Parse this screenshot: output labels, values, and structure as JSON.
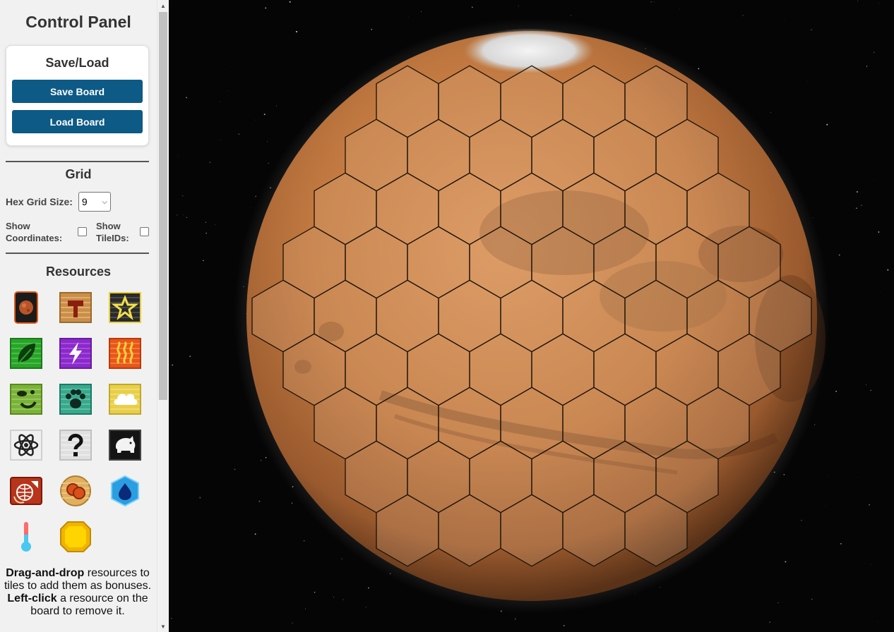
{
  "panel": {
    "title": "Control Panel",
    "saveload": {
      "title": "Save/Load",
      "save_label": "Save Board",
      "load_label": "Load Board"
    },
    "grid": {
      "title": "Grid",
      "size_label": "Hex Grid Size:",
      "size_value": "9",
      "show_coords_label_1": "Show",
      "show_coords_label_2": "Coordinates:",
      "show_tileids_label_1": "Show",
      "show_tileids_label_2": "TileIDs:"
    },
    "resources": {
      "title": "Resources",
      "items": [
        {
          "icon": "mars-card-icon"
        },
        {
          "icon": "building-tag-icon"
        },
        {
          "icon": "star-tag-icon"
        },
        {
          "icon": "plant-tag-icon"
        },
        {
          "icon": "power-tag-icon"
        },
        {
          "icon": "heat-tag-icon"
        },
        {
          "icon": "microbe-tag-icon"
        },
        {
          "icon": "animal-tag-icon"
        },
        {
          "icon": "cloud-tag-icon"
        },
        {
          "icon": "science-tag-icon"
        },
        {
          "icon": "wild-tag-icon"
        },
        {
          "icon": "pig-tag-icon"
        },
        {
          "icon": "earth-event-icon"
        },
        {
          "icon": "mc-coins-icon"
        },
        {
          "icon": "water-ocean-icon"
        },
        {
          "icon": "temperature-icon"
        },
        {
          "icon": "titanium-icon"
        }
      ]
    },
    "help": {
      "bold1": "Drag-and-drop",
      "text1": " resources to tiles to add them as bonuses.",
      "bold2": "Left-click",
      "text2": " a resource on the board to remove it."
    }
  },
  "board": {
    "hex_rows": [
      5,
      6,
      7,
      8,
      9,
      8,
      7,
      6,
      5
    ],
    "colors": {
      "button": "#0d5a86",
      "planet_base": "#c07840",
      "hex_stroke": "#1a1208",
      "space": "#050505"
    }
  }
}
